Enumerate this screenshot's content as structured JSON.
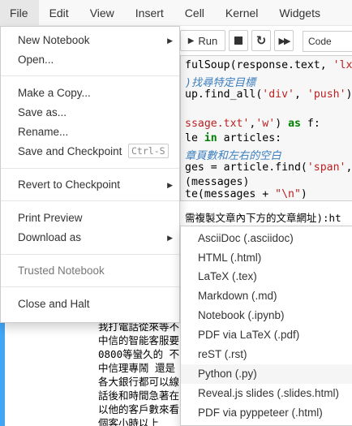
{
  "menubar": {
    "items": [
      "File",
      "Edit",
      "View",
      "Insert",
      "Cell",
      "Kernel",
      "Widgets"
    ]
  },
  "toolbar": {
    "run_label": "Run",
    "stop_icon": "stop-icon",
    "restart_icon": "restart-icon",
    "fastforward_icon": "fast-forward-icon",
    "cell_type": "Code"
  },
  "code_lines": [
    "fulSoup(response.text, 'lxml",
    ")找尋特定目標",
    "up.find_all('div', 'push')",
    "",
    "ssage.txt','w') as f:",
    "le in articles:",
    "章頁數和左右的空白",
    "ges = article.find('span','f",
    "(messages)",
    "te(messages + \"\\n\")"
  ],
  "output_line": "需複製文章內下方的文章網址):ht",
  "output_text": [
    "我打電話從來等不",
    "中信的智能客服要",
    "0800等蠻久的 不",
    "中信理專鬧 還是",
    "各大銀行都可以線",
    "話後和時間急著在",
    "以他的客戶數來看",
    "個客小時以上"
  ],
  "file_menu": {
    "new_notebook": "New Notebook",
    "open": "Open...",
    "make_copy": "Make a Copy...",
    "save_as": "Save as...",
    "rename": "Rename...",
    "save_checkpoint": "Save and Checkpoint",
    "save_shortcut": "Ctrl-S",
    "revert": "Revert to Checkpoint",
    "print_preview": "Print Preview",
    "download_as": "Download as",
    "trusted": "Trusted Notebook",
    "close_halt": "Close and Halt"
  },
  "download_menu": {
    "items": [
      "AsciiDoc (.asciidoc)",
      "HTML (.html)",
      "LaTeX (.tex)",
      "Markdown (.md)",
      "Notebook (.ipynb)",
      "PDF via LaTeX (.pdf)",
      "reST (.rst)",
      "Python (.py)",
      "Reveal.js slides (.slides.html)",
      "PDF via pyppeteer (.html)"
    ],
    "hovered": "Python (.py)"
  }
}
